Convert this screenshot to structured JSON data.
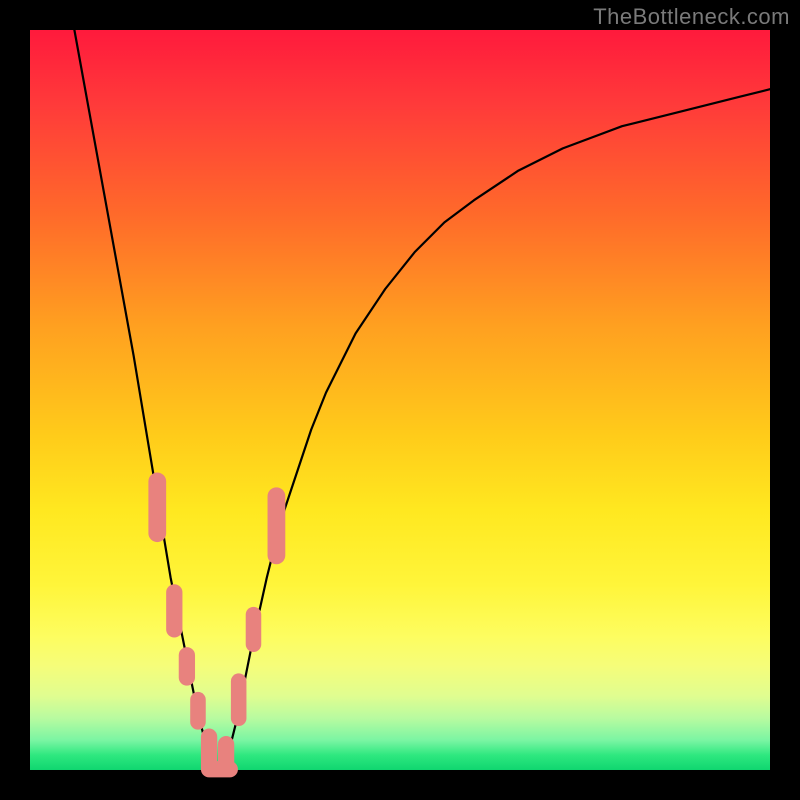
{
  "watermark": "TheBottleneck.com",
  "chart_data": {
    "type": "line",
    "title": "",
    "xlabel": "",
    "ylabel": "",
    "xlim": [
      0,
      100
    ],
    "ylim": [
      0,
      100
    ],
    "curve_left": {
      "x": [
        6,
        8,
        10,
        12,
        14,
        16,
        17,
        18,
        19,
        20,
        21,
        22,
        22.5,
        23,
        23.5,
        24,
        24.5,
        25,
        25.5
      ],
      "y": [
        100,
        89,
        78,
        67,
        56,
        44,
        38,
        32,
        26,
        21,
        16,
        11,
        8.5,
        6.5,
        4.5,
        3,
        1.8,
        0.8,
        0.2
      ]
    },
    "curve_right": {
      "x": [
        25.5,
        26,
        27,
        28,
        29,
        30,
        32,
        34,
        36,
        38,
        40,
        44,
        48,
        52,
        56,
        60,
        66,
        72,
        80,
        88,
        96,
        100
      ],
      "y": [
        0.2,
        0.8,
        3,
        7,
        12,
        17,
        26,
        34,
        40,
        46,
        51,
        59,
        65,
        70,
        74,
        77,
        81,
        84,
        87,
        89,
        91,
        92
      ]
    },
    "markers_left": {
      "shape": "rounded",
      "color": "#e8827e",
      "clusters": [
        {
          "x": 17.2,
          "y_start": 39,
          "y_end": 32,
          "width": 2.4
        },
        {
          "x": 19.5,
          "y_start": 24,
          "y_end": 19,
          "width": 2.2
        },
        {
          "x": 21.2,
          "y_start": 15.5,
          "y_end": 12.5,
          "width": 2.2
        },
        {
          "x": 22.7,
          "y_start": 9.5,
          "y_end": 6.5,
          "width": 2.1
        },
        {
          "x": 24.2,
          "y_start": 4.5,
          "y_end": 0.2,
          "width": 2.2
        }
      ]
    },
    "markers_right": {
      "shape": "rounded",
      "color": "#e8827e",
      "clusters": [
        {
          "x": 26.5,
          "y_start": 0.2,
          "y_end": 3.5,
          "width": 2.2
        },
        {
          "x": 28.2,
          "y_start": 7,
          "y_end": 12,
          "width": 2.1
        },
        {
          "x": 30.2,
          "y_start": 17,
          "y_end": 21,
          "width": 2.1
        },
        {
          "x": 33.3,
          "y_start": 29,
          "y_end": 37,
          "width": 2.4
        }
      ]
    },
    "markers_bottom": {
      "shape": "rounded",
      "color": "#e8827e",
      "clusters": [
        {
          "y": 0.1,
          "x_start": 24.2,
          "x_end": 27.0,
          "height": 2.2
        }
      ]
    }
  }
}
